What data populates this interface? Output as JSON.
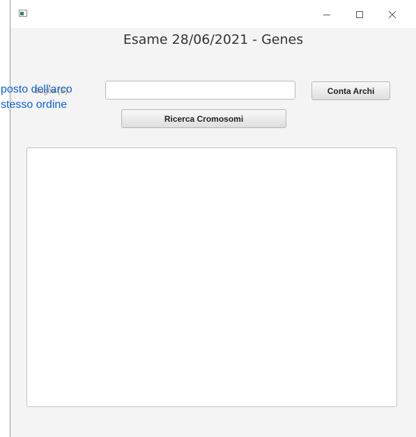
{
  "window": {
    "title": "",
    "controls": {
      "minimize_icon": "minimize-icon",
      "maximize_icon": "maximize-icon",
      "close_icon": "close-icon"
    }
  },
  "header": {
    "title": "Esame 28/06/2021 - Genes"
  },
  "form": {
    "side_label_line1": "posto dell'arco",
    "side_label_line2": "stesso ordine",
    "side_label_ghost": "Soglia (S)",
    "input_value": "",
    "conta_archi_label": "Conta Archi",
    "ricerca_label": "Ricerca Cromosomi"
  },
  "output": {
    "text": ""
  },
  "colors": {
    "label_blue": "#0a5fd0",
    "window_bg": "#f4f4f4"
  }
}
